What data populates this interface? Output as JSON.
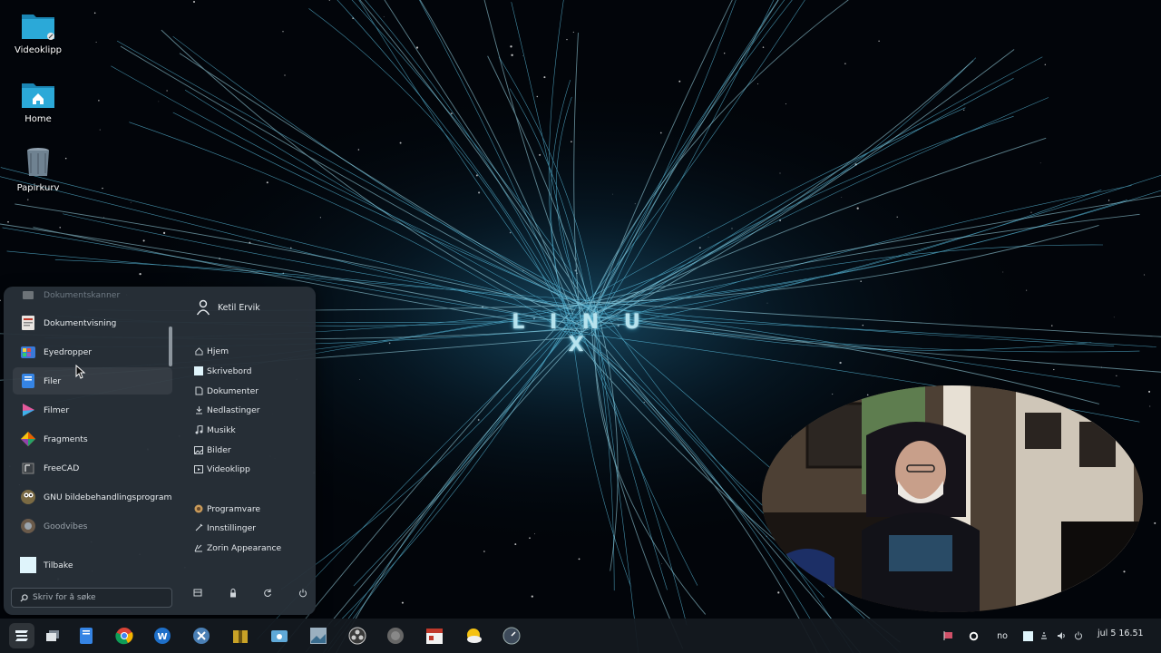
{
  "wallpaper": {
    "title": "L I N U X"
  },
  "desktop": {
    "icons": [
      {
        "label": "Videoklipp",
        "icon": "folder-video-icon"
      },
      {
        "label": "Home",
        "icon": "folder-home-icon"
      },
      {
        "label": "Papirkurv",
        "icon": "trash-icon"
      }
    ]
  },
  "start_menu": {
    "apps": [
      {
        "label": "Dokumentskanner",
        "icon": "scanner-icon"
      },
      {
        "label": "Dokumentvisning",
        "icon": "document-viewer-icon"
      },
      {
        "label": "Eyedropper",
        "icon": "eyedropper-icon"
      },
      {
        "label": "Filer",
        "icon": "files-icon"
      },
      {
        "label": "Filmer",
        "icon": "videos-icon"
      },
      {
        "label": "Fragments",
        "icon": "fragments-icon"
      },
      {
        "label": "FreeCAD",
        "icon": "freecad-icon"
      },
      {
        "label": "GNU bildebehandlingsprogram",
        "icon": "gimp-icon"
      },
      {
        "label": "Goodvibes",
        "icon": "goodvibes-icon"
      }
    ],
    "back_label": "Tilbake",
    "search_placeholder": "Skriv for å søke",
    "user_name": "Ketil Ervik",
    "places": [
      {
        "label": "Hjem",
        "icon": "home-icon"
      },
      {
        "label": "Skrivebord",
        "icon": "desktop-icon"
      },
      {
        "label": "Dokumenter",
        "icon": "documents-icon"
      },
      {
        "label": "Nedlastinger",
        "icon": "downloads-icon"
      },
      {
        "label": "Musikk",
        "icon": "music-icon"
      },
      {
        "label": "Bilder",
        "icon": "pictures-icon"
      },
      {
        "label": "Videoklipp",
        "icon": "videos-folder-icon"
      }
    ],
    "system": [
      {
        "label": "Programvare",
        "icon": "software-icon"
      },
      {
        "label": "Innstillinger",
        "icon": "settings-icon"
      },
      {
        "label": "Zorin Appearance",
        "icon": "appearance-icon"
      }
    ]
  },
  "taskbar": {
    "language": "no",
    "clock": "jul 5  16.51"
  }
}
